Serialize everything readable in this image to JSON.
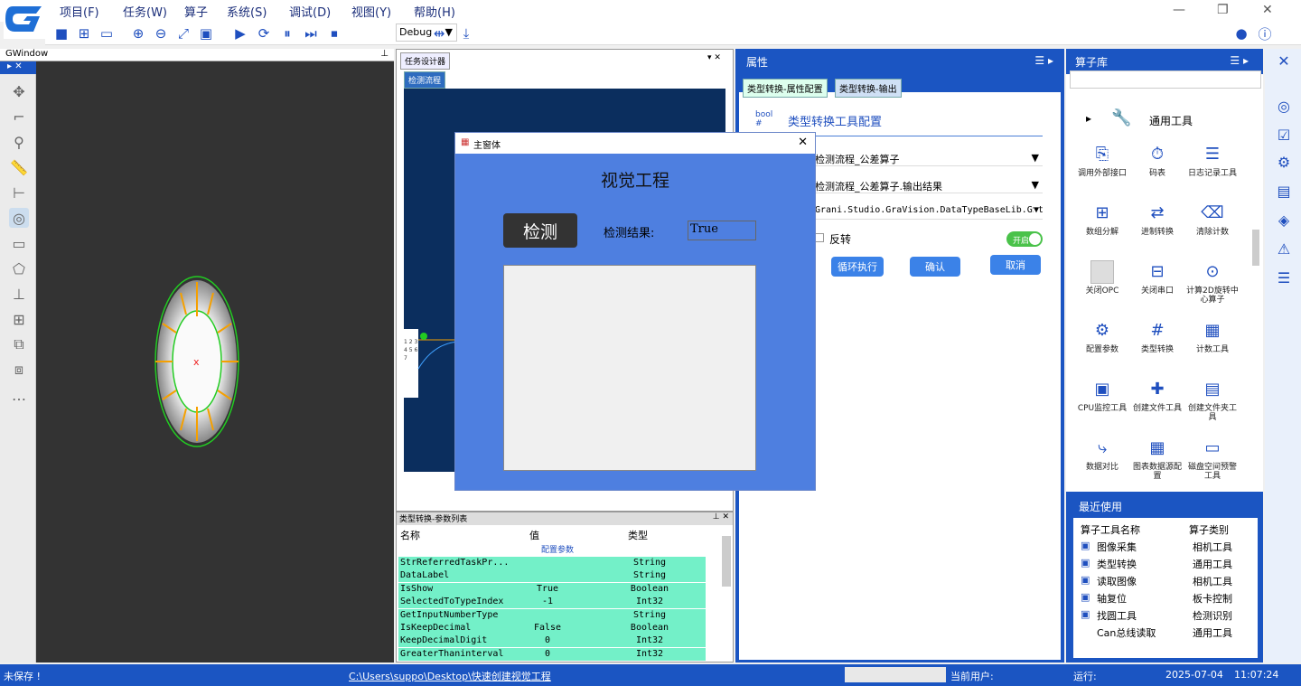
{
  "menu": [
    "项目(F)",
    "任务(W)",
    "算子",
    "系统(S)",
    "调试(D)",
    "视图(Y)",
    "帮助(H)"
  ],
  "toolbar": {
    "mode": "Debug"
  },
  "gwindow": {
    "title": "GWindow"
  },
  "task_designer": {
    "tab": "任务设计器",
    "sub_tab": "检测流程"
  },
  "param_list": {
    "title": "类型转换-参数列表",
    "headers": [
      "名称",
      "值",
      "类型"
    ],
    "group": "配置参数",
    "rows": [
      [
        "StrReferredTaskPr...",
        "",
        "String"
      ],
      [
        "DataLabel",
        "",
        "String"
      ],
      [
        "IsShow",
        "True",
        "Boolean"
      ],
      [
        "SelectedToTypeIndex",
        "-1",
        "Int32"
      ],
      [
        "GetInputNumberType",
        "",
        "String"
      ],
      [
        "IsKeepDecimal",
        "False",
        "Boolean"
      ],
      [
        "KeepDecimalDigit",
        "0",
        "Int32"
      ],
      [
        "GreaterThaninterval",
        "0",
        "Int32"
      ]
    ]
  },
  "properties": {
    "title": "属性",
    "tab1": "类型转换-属性配置",
    "tab2": "类型转换-输出",
    "heading": "类型转换工具配置",
    "combo1": "检测流程_公差算子",
    "combo2": "检测流程_公差算子.输出结果",
    "combo3": "Grani.Studio.GraVision.DataTypeBaseLib.GStri",
    "reverse": "反转",
    "toggle": "开启",
    "btn_loop": "循环执行",
    "btn_ok": "确认",
    "btn_cancel": "取消"
  },
  "library": {
    "title": "算子库",
    "category": "通用工具",
    "items": [
      "调用外部接口",
      "码表",
      "日志记录工具",
      "数组分解",
      "进制转换",
      "清除计数",
      "关闭OPC",
      "关闭串口",
      "计算2D旋转中心算子",
      "配置参数",
      "类型转换",
      "计数工具",
      "CPU监控工具",
      "创建文件工具",
      "创建文件夹工具",
      "数据对比",
      "图表数据源配置",
      "磁盘空间预警工具"
    ],
    "recent_title": "最近使用",
    "recent_headers": [
      "算子工具名称",
      "算子类别"
    ],
    "recent": [
      [
        "图像采集",
        "相机工具"
      ],
      [
        "类型转换",
        "通用工具"
      ],
      [
        "读取图像",
        "相机工具"
      ],
      [
        "轴复位",
        "板卡控制"
      ],
      [
        "找圆工具",
        "检测识别"
      ],
      [
        "Can总线读取",
        "通用工具"
      ]
    ]
  },
  "dialog": {
    "title": "主窗体",
    "heading": "视觉工程",
    "detect_btn": "检测",
    "result_label": "检测结果:",
    "result_value": "True"
  },
  "status": {
    "save": "未保存 !",
    "path": "C:\\Users\\suppo\\Desktop\\快速创建视觉工程",
    "user": "当前用户:",
    "run": "运行:",
    "date": "2025-07-04",
    "time": "11:07:24"
  }
}
